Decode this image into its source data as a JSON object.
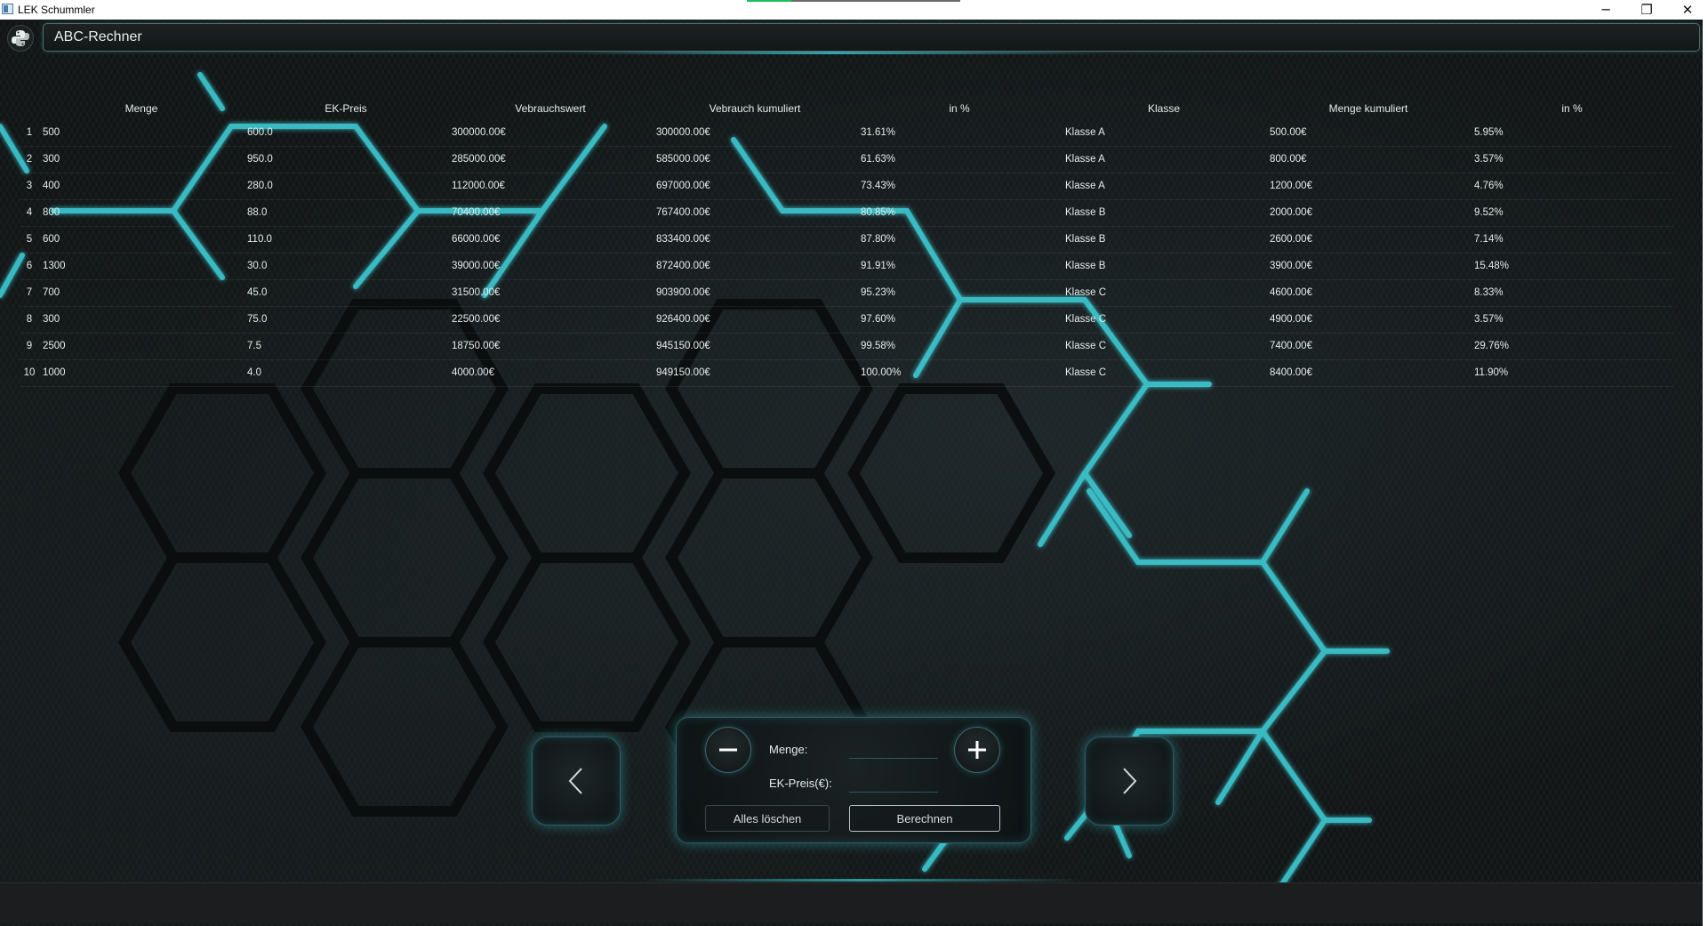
{
  "window": {
    "title": "LEK Schummler",
    "minimize_glyph": "─",
    "maximize_glyph": "❐",
    "close_glyph": "✕"
  },
  "header": {
    "logo_icon": "python-logo-icon",
    "title": "ABC-Rechner"
  },
  "table": {
    "columns": [
      "",
      "Menge",
      "EK-Preis",
      "Vebrauchswert",
      "Vebrauch kumuliert",
      "in %",
      "Klasse",
      "Menge kumuliert",
      "in %"
    ],
    "rows": [
      [
        "1",
        "500",
        "600.0",
        "300000.00€",
        "300000.00€",
        "31.61%",
        "Klasse A",
        "500.00€",
        "5.95%"
      ],
      [
        "2",
        "300",
        "950.0",
        "285000.00€",
        "585000.00€",
        "61.63%",
        "Klasse A",
        "800.00€",
        "3.57%"
      ],
      [
        "3",
        "400",
        "280.0",
        "112000.00€",
        "697000.00€",
        "73.43%",
        "Klasse A",
        "1200.00€",
        "4.76%"
      ],
      [
        "4",
        "800",
        "88.0",
        "70400.00€",
        "767400.00€",
        "80.85%",
        "Klasse B",
        "2000.00€",
        "9.52%"
      ],
      [
        "5",
        "600",
        "110.0",
        "66000.00€",
        "833400.00€",
        "87.80%",
        "Klasse B",
        "2600.00€",
        "7.14%"
      ],
      [
        "6",
        "1300",
        "30.0",
        "39000.00€",
        "872400.00€",
        "91.91%",
        "Klasse B",
        "3900.00€",
        "15.48%"
      ],
      [
        "7",
        "700",
        "45.0",
        "31500.00€",
        "903900.00€",
        "95.23%",
        "Klasse C",
        "4600.00€",
        "8.33%"
      ],
      [
        "8",
        "300",
        "75.0",
        "22500.00€",
        "926400.00€",
        "97.60%",
        "Klasse C",
        "4900.00€",
        "3.57%"
      ],
      [
        "9",
        "2500",
        "7.5",
        "18750.00€",
        "945150.00€",
        "99.58%",
        "Klasse C",
        "7400.00€",
        "29.76%"
      ],
      [
        "10",
        "1000",
        "4.0",
        "4000.00€",
        "949150.00€",
        "100.00%",
        "Klasse C",
        "8400.00€",
        "11.90%"
      ]
    ]
  },
  "controls": {
    "prev_icon": "chevron-left-icon",
    "next_icon": "chevron-right-icon",
    "minus_icon": "minus-icon",
    "plus_icon": "plus-icon",
    "menge_label": "Menge:",
    "menge_value": "",
    "preis_label": "EK-Preis(€):",
    "preis_value": "",
    "clear_label": "Alles löschen",
    "calc_label": "Berechnen"
  },
  "colors": {
    "accent": "#3fd6e0",
    "background": "#111516",
    "text": "#e6ecec"
  }
}
